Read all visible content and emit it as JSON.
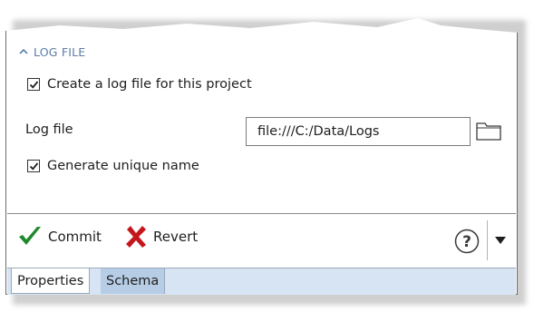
{
  "panel": {
    "section_title": "LOG FILE",
    "section_icon": "chevron-up-icon",
    "create_log": {
      "label": "Create a log file for this project",
      "checked": true
    },
    "log_file": {
      "label": "Log file",
      "value": "file:///C:/Data/Logs",
      "browse_icon": "folder-icon"
    },
    "unique_name": {
      "label": "Generate unique name",
      "checked": true
    }
  },
  "toolbar": {
    "commit_label": "Commit",
    "commit_icon": "checkmark-icon",
    "commit_color": "#1e8a2e",
    "revert_label": "Revert",
    "revert_icon": "x-icon",
    "revert_color": "#c4171c",
    "help_icon": "help-icon",
    "dropdown_icon": "triangle-down-icon"
  },
  "tabs": [
    {
      "label": "Properties",
      "active": true
    },
    {
      "label": "Schema",
      "active": false
    }
  ],
  "colors": {
    "header_text": "#5b7da8",
    "tabbar_bg": "#d6e4f3",
    "inactive_tab_bg": "#b7cde6"
  }
}
